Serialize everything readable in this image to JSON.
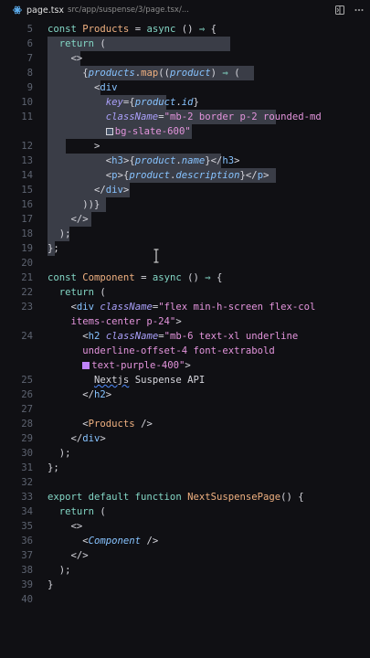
{
  "tab": {
    "filename": "page.tsx",
    "path": "src/app/suspense/3/page.tsx/..."
  },
  "icons": {
    "file": "react-file-icon",
    "action1": "split-editor-icon",
    "action2": "more-icon"
  },
  "lines": [
    {
      "n": "5",
      "t": [
        {
          "c": "kw",
          "v": "const "
        },
        {
          "c": "ty",
          "v": "Products"
        },
        {
          "c": "pl",
          "v": " = "
        },
        {
          "c": "kw",
          "v": "async"
        },
        {
          "c": "pl",
          "v": " () "
        },
        {
          "c": "op",
          "v": "⇒"
        },
        {
          "c": "pl",
          "v": " {"
        }
      ]
    },
    {
      "n": "6",
      "t": [
        {
          "c": "kw",
          "v": "  return"
        },
        {
          "c": "pl",
          "v": " ("
        }
      ]
    },
    {
      "n": "7",
      "t": [
        {
          "c": "pl",
          "v": "    <>"
        }
      ]
    },
    {
      "n": "8",
      "t": [
        {
          "c": "pl",
          "v": "      "
        },
        {
          "c": "br1",
          "v": "{"
        },
        {
          "c": "vr",
          "v": "products"
        },
        {
          "c": "pl",
          "v": "."
        },
        {
          "c": "fn",
          "v": "map"
        },
        {
          "c": "pl",
          "v": "(("
        },
        {
          "c": "vr",
          "v": "product"
        },
        {
          "c": "pl",
          "v": ") "
        },
        {
          "c": "op",
          "v": "⇒"
        },
        {
          "c": "pl",
          "v": " ("
        }
      ]
    },
    {
      "n": "9",
      "t": [
        {
          "c": "pl",
          "v": "        <"
        },
        {
          "c": "tg",
          "v": "div"
        }
      ]
    },
    {
      "n": "10",
      "t": [
        {
          "c": "pl",
          "v": "          "
        },
        {
          "c": "at",
          "v": "key"
        },
        {
          "c": "pl",
          "v": "={"
        },
        {
          "c": "vr",
          "v": "product"
        },
        {
          "c": "pl",
          "v": "."
        },
        {
          "c": "vr",
          "v": "id"
        },
        {
          "c": "pl",
          "v": "}"
        }
      ]
    },
    {
      "n": "11",
      "t": [
        {
          "c": "pl",
          "v": "          "
        },
        {
          "c": "at",
          "v": "className"
        },
        {
          "c": "pl",
          "v": "="
        },
        {
          "c": "st",
          "v": "\"mb-2 border p-2 rounded-md"
        }
      ]
    },
    {
      "n": "",
      "t": [
        {
          "c": "pl",
          "v": "          "
        },
        {
          "c": "swatch",
          "v": ""
        },
        {
          "c": "st",
          "v": "bg-slate-600\""
        }
      ]
    },
    {
      "n": "12",
      "t": [
        {
          "c": "pl",
          "v": "        >"
        }
      ]
    },
    {
      "n": "13",
      "t": [
        {
          "c": "pl",
          "v": "          <"
        },
        {
          "c": "tg",
          "v": "h3"
        },
        {
          "c": "pl",
          "v": ">{"
        },
        {
          "c": "vr",
          "v": "product"
        },
        {
          "c": "pl",
          "v": "."
        },
        {
          "c": "vr",
          "v": "name"
        },
        {
          "c": "pl",
          "v": "}</"
        },
        {
          "c": "tg",
          "v": "h3"
        },
        {
          "c": "pl",
          "v": ">"
        }
      ]
    },
    {
      "n": "14",
      "t": [
        {
          "c": "pl",
          "v": "          <"
        },
        {
          "c": "tg",
          "v": "p"
        },
        {
          "c": "pl",
          "v": ">{"
        },
        {
          "c": "vr",
          "v": "product"
        },
        {
          "c": "pl",
          "v": "."
        },
        {
          "c": "vr",
          "v": "description"
        },
        {
          "c": "pl",
          "v": "}</"
        },
        {
          "c": "tg",
          "v": "p"
        },
        {
          "c": "pl",
          "v": ">"
        }
      ]
    },
    {
      "n": "15",
      "t": [
        {
          "c": "pl",
          "v": "        </"
        },
        {
          "c": "tg",
          "v": "div"
        },
        {
          "c": "pl",
          "v": ">"
        }
      ]
    },
    {
      "n": "16",
      "t": [
        {
          "c": "pl",
          "v": "      ))"
        },
        {
          "c": "br1",
          "v": "}"
        }
      ]
    },
    {
      "n": "17",
      "t": [
        {
          "c": "pl",
          "v": "    </>"
        }
      ]
    },
    {
      "n": "18",
      "t": [
        {
          "c": "pl",
          "v": "  );"
        }
      ]
    },
    {
      "n": "19",
      "t": [
        {
          "c": "pl",
          "v": "};"
        }
      ]
    },
    {
      "n": "20",
      "t": []
    },
    {
      "n": "21",
      "t": [
        {
          "c": "kw",
          "v": "const "
        },
        {
          "c": "ty",
          "v": "Component"
        },
        {
          "c": "pl",
          "v": " = "
        },
        {
          "c": "kw",
          "v": "async"
        },
        {
          "c": "pl",
          "v": " () "
        },
        {
          "c": "op",
          "v": "⇒"
        },
        {
          "c": "pl",
          "v": " {"
        }
      ]
    },
    {
      "n": "22",
      "t": [
        {
          "c": "kw",
          "v": "  return"
        },
        {
          "c": "pl",
          "v": " ("
        }
      ]
    },
    {
      "n": "23",
      "t": [
        {
          "c": "pl",
          "v": "    <"
        },
        {
          "c": "tg",
          "v": "div"
        },
        {
          "c": "pl",
          "v": " "
        },
        {
          "c": "at",
          "v": "className"
        },
        {
          "c": "pl",
          "v": "="
        },
        {
          "c": "st",
          "v": "\"flex min-h-screen flex-col"
        }
      ]
    },
    {
      "n": "",
      "t": [
        {
          "c": "st",
          "v": "    items-center p-24\""
        },
        {
          "c": "pl",
          "v": ">"
        }
      ]
    },
    {
      "n": "24",
      "t": [
        {
          "c": "pl",
          "v": "      <"
        },
        {
          "c": "tg",
          "v": "h2"
        },
        {
          "c": "pl",
          "v": " "
        },
        {
          "c": "at",
          "v": "className"
        },
        {
          "c": "pl",
          "v": "="
        },
        {
          "c": "st",
          "v": "\"mb-6 text-xl underline"
        }
      ]
    },
    {
      "n": "",
      "t": [
        {
          "c": "st",
          "v": "      underline-offset-4 font-extrabold"
        }
      ]
    },
    {
      "n": "",
      "t": [
        {
          "c": "pl",
          "v": "      "
        },
        {
          "c": "swatchp",
          "v": ""
        },
        {
          "c": "st",
          "v": "text-purple-400\""
        },
        {
          "c": "pl",
          "v": ">"
        }
      ]
    },
    {
      "n": "25",
      "t": [
        {
          "c": "pl",
          "v": "        "
        },
        {
          "c": "sq",
          "v": "Nextjs"
        },
        {
          "c": "pl",
          "v": " Suspense API"
        }
      ]
    },
    {
      "n": "26",
      "t": [
        {
          "c": "pl",
          "v": "      </"
        },
        {
          "c": "tg",
          "v": "h2"
        },
        {
          "c": "pl",
          "v": ">"
        }
      ]
    },
    {
      "n": "27",
      "t": []
    },
    {
      "n": "28",
      "t": [
        {
          "c": "pl",
          "v": "      <"
        },
        {
          "c": "ty",
          "v": "Products"
        },
        {
          "c": "pl",
          "v": " />"
        }
      ]
    },
    {
      "n": "29",
      "t": [
        {
          "c": "pl",
          "v": "    </"
        },
        {
          "c": "tg",
          "v": "div"
        },
        {
          "c": "pl",
          "v": ">"
        }
      ]
    },
    {
      "n": "30",
      "t": [
        {
          "c": "pl",
          "v": "  );"
        }
      ]
    },
    {
      "n": "31",
      "t": [
        {
          "c": "pl",
          "v": "};"
        }
      ]
    },
    {
      "n": "32",
      "t": []
    },
    {
      "n": "33",
      "t": [
        {
          "c": "kw",
          "v": "export default function "
        },
        {
          "c": "fn",
          "v": "NextSuspensePage"
        },
        {
          "c": "pl",
          "v": "() {"
        }
      ]
    },
    {
      "n": "34",
      "t": [
        {
          "c": "kw",
          "v": "  return"
        },
        {
          "c": "pl",
          "v": " ("
        }
      ]
    },
    {
      "n": "35",
      "t": [
        {
          "c": "pl",
          "v": "    <>"
        }
      ]
    },
    {
      "n": "36",
      "t": [
        {
          "c": "pl",
          "v": "      <"
        },
        {
          "c": "vi",
          "v": "Component"
        },
        {
          "c": "pl",
          "v": " />"
        }
      ]
    },
    {
      "n": "37",
      "t": [
        {
          "c": "pl",
          "v": "    </>"
        }
      ]
    },
    {
      "n": "38",
      "t": [
        {
          "c": "pl",
          "v": "  );"
        }
      ]
    },
    {
      "n": "39",
      "t": [
        {
          "c": "pl",
          "v": "}"
        }
      ]
    },
    {
      "n": "40",
      "t": []
    }
  ]
}
